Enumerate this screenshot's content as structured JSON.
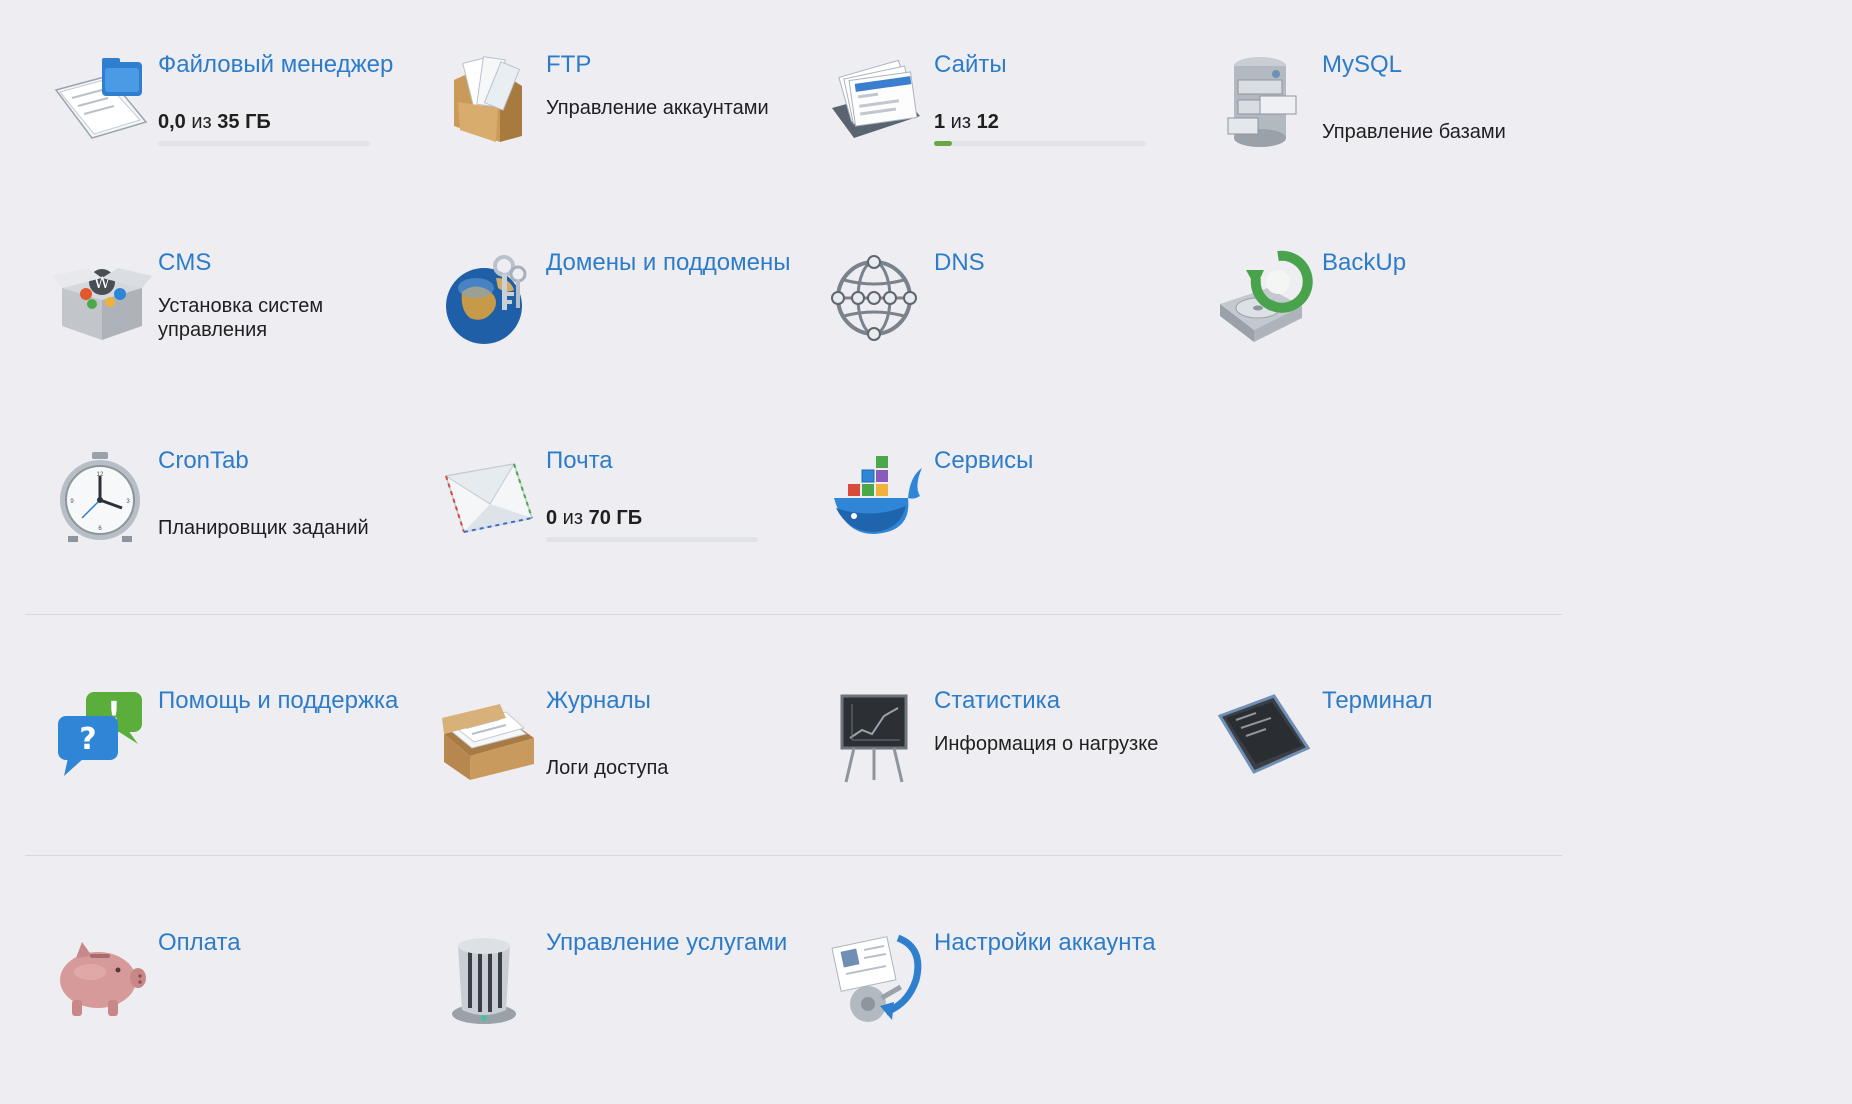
{
  "tiles": {
    "file_manager": {
      "title": "Файловый менеджер",
      "quota_used": "0,0",
      "quota_sep": " из ",
      "quota_total": "35 ГБ",
      "usage_fraction": 0.0
    },
    "ftp": {
      "title": "FTP",
      "desc": "Управление аккаунтами"
    },
    "sites": {
      "title": "Сайты",
      "quota_used": "1",
      "quota_sep": " из ",
      "quota_total": "12",
      "usage_fraction": 0.083
    },
    "mysql": {
      "title": "MySQL",
      "desc": "Управление базами"
    },
    "cms": {
      "title": "CMS",
      "desc": "Установка систем управления"
    },
    "domains": {
      "title": "Домены и поддомены"
    },
    "dns": {
      "title": "DNS"
    },
    "backup": {
      "title": "BackUp"
    },
    "crontab": {
      "title": "CronTab",
      "desc": "Планировщик заданий"
    },
    "mail": {
      "title": "Почта",
      "quota_used": "0",
      "quota_sep": " из ",
      "quota_total": "70 ГБ",
      "usage_fraction": 0.0
    },
    "services": {
      "title": "Сервисы"
    },
    "support": {
      "title": "Помощь и поддержка"
    },
    "logs": {
      "title": "Журналы",
      "desc": "Логи доступа"
    },
    "stats": {
      "title": "Статистика",
      "desc": "Информация о нагрузке"
    },
    "terminal": {
      "title": "Терминал"
    },
    "payment": {
      "title": "Оплата"
    },
    "service_management": {
      "title": "Управление услугами"
    },
    "account_settings": {
      "title": "Настройки аккаунта"
    }
  },
  "colors": {
    "link": "#2d7cc9",
    "progress": "#6aa843",
    "background": "#eeeef2"
  }
}
